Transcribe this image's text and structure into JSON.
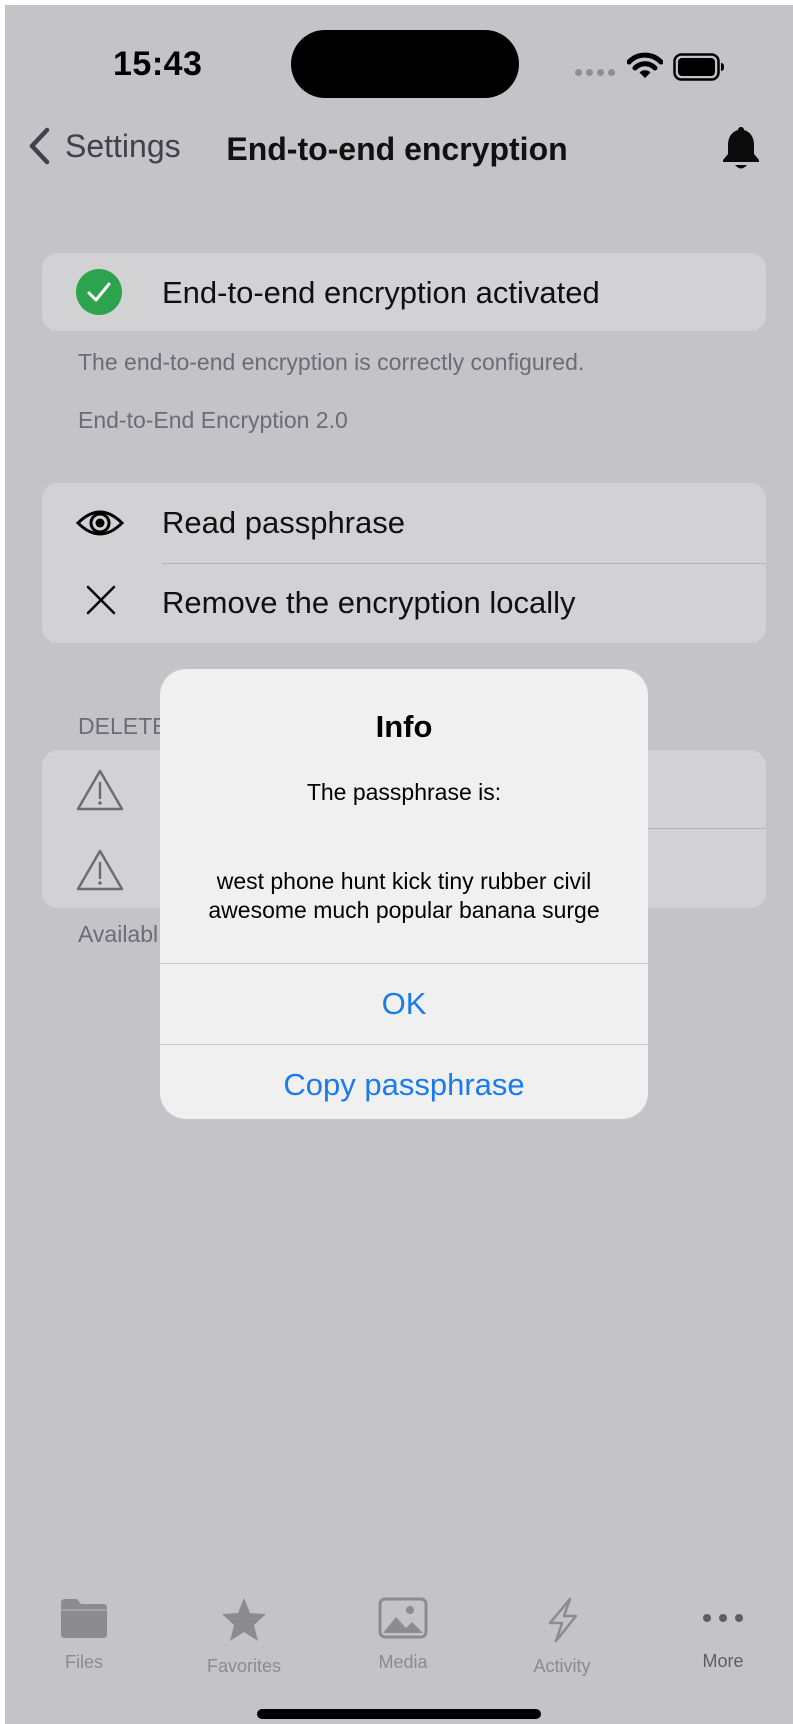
{
  "status": {
    "time": "15:43"
  },
  "nav": {
    "back_label": "Settings",
    "title": "End-to-end encryption"
  },
  "status_card": {
    "label": "End-to-end encryption activated",
    "note": "The end-to-end encryption is correctly configured.",
    "version": "End-to-End Encryption 2.0"
  },
  "actions": [
    {
      "label": "Read passphrase",
      "icon": "eye-icon"
    },
    {
      "label": "Remove the encryption locally",
      "icon": "x-icon"
    }
  ],
  "delete_section": {
    "header": "DELETE",
    "footer": "Availabl"
  },
  "dialog": {
    "title": "Info",
    "message": "The passphrase is:",
    "passphrase": "west phone hunt kick tiny rubber civil awesome much popular banana surge",
    "ok_label": "OK",
    "copy_label": "Copy passphrase"
  },
  "tabbar": [
    {
      "label": "Files",
      "icon": "folder-icon"
    },
    {
      "label": "Favorites",
      "icon": "star-icon"
    },
    {
      "label": "Media",
      "icon": "photo-icon"
    },
    {
      "label": "Activity",
      "icon": "bolt-icon"
    },
    {
      "label": "More",
      "icon": "ellipsis-icon"
    }
  ],
  "colors": {
    "accent": "#1a7ce8",
    "success": "#2ca44d",
    "overlay_bg": "#c3c3c8"
  }
}
